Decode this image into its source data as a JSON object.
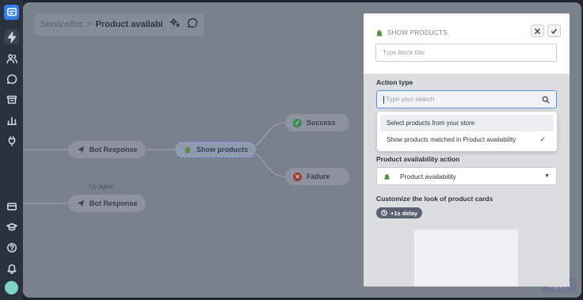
{
  "sidebar": {
    "items": [
      {
        "icon": "chat-logo-icon"
      },
      {
        "icon": "bolt-icon"
      },
      {
        "icon": "users-icon"
      },
      {
        "icon": "chat-bubble-icon"
      },
      {
        "icon": "archive-icon"
      },
      {
        "icon": "bar-chart-icon"
      },
      {
        "icon": "plug-icon"
      },
      {
        "icon": "credit-card-icon"
      },
      {
        "icon": "graduation-cap-icon"
      },
      {
        "icon": "help-icon"
      },
      {
        "icon": "bell-icon"
      },
      {
        "icon": "avatar"
      }
    ]
  },
  "breadcrumb": {
    "root": "ServiceBot",
    "separator": ">",
    "current": "Product availability"
  },
  "canvas": {
    "nodes": {
      "bot_response_1": "Bot Response",
      "show_products": "Show products",
      "success": "Success",
      "failure": "Failure",
      "try_again": "Try again",
      "bot_response_2": "Bot Response"
    },
    "support_label": "Support"
  },
  "panel": {
    "title": "SHOW PRODUCTS",
    "title_placeholder": "Type block title",
    "action_type_label": "Action type",
    "search_placeholder": "Type your search",
    "options": [
      {
        "label": "Select products from your store",
        "selected": false
      },
      {
        "label": "Show products matched in Product availability",
        "selected": true
      }
    ],
    "check_mark": "✓",
    "availability_action_label": "Product availability action",
    "availability_value": "Product availability",
    "customize_label": "Customize the look of product cards",
    "delay_label": "+1s delay"
  },
  "colors": {
    "accent": "#2f80ed",
    "success": "#3b8a55",
    "failure": "#9a3b3b",
    "shopify": "#5e8e3e"
  }
}
